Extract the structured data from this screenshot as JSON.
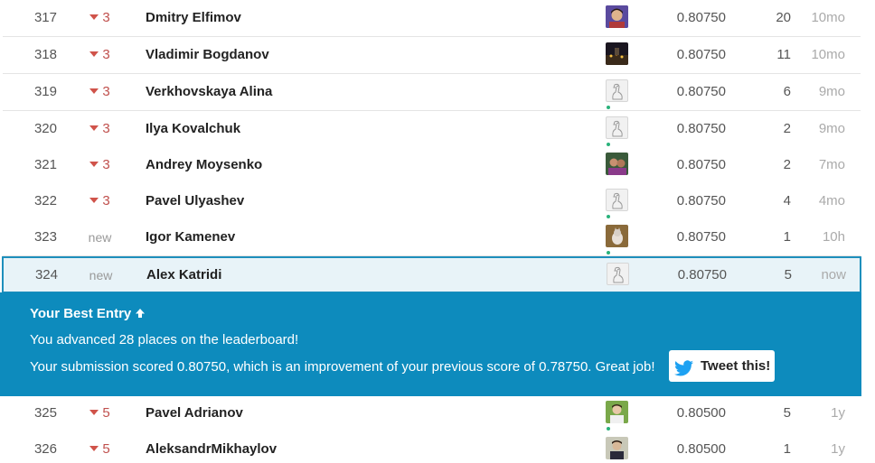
{
  "leaderboard": {
    "rows_before": [
      {
        "rank": "317",
        "delta": "3",
        "delta_type": "down",
        "name": "Dmitry Elfimov",
        "avatar": "avatar-photo-person",
        "score": "0.80750",
        "entries": "20",
        "last": "10mo"
      },
      {
        "rank": "318",
        "delta": "3",
        "delta_type": "down",
        "name": "Vladimir Bogdanov",
        "avatar": "avatar-photo-night-city",
        "score": "0.80750",
        "entries": "11",
        "last": "10mo"
      },
      {
        "rank": "319",
        "delta": "3",
        "delta_type": "down",
        "name": "Verkhovskaya Alina",
        "avatar": "avatar-default-goose",
        "score": "0.80750",
        "entries": "6",
        "last": "9mo"
      },
      {
        "rank": "320",
        "delta": "3",
        "delta_type": "down",
        "name": "Ilya Kovalchuk",
        "avatar": "avatar-default-goose",
        "score": "0.80750",
        "entries": "2",
        "last": "9mo"
      },
      {
        "rank": "321",
        "delta": "3",
        "delta_type": "down",
        "name": "Andrey Moysenko",
        "avatar": "avatar-photo-people",
        "score": "0.80750",
        "entries": "2",
        "last": "7mo"
      },
      {
        "rank": "322",
        "delta": "3",
        "delta_type": "down",
        "name": "Pavel Ulyashev",
        "avatar": "avatar-default-goose",
        "score": "0.80750",
        "entries": "4",
        "last": "4mo"
      },
      {
        "rank": "323",
        "delta": "new",
        "delta_type": "new",
        "name": "Igor Kamenev",
        "avatar": "avatar-photo-cat",
        "score": "0.80750",
        "entries": "1",
        "last": "10h"
      },
      {
        "rank": "324",
        "delta": "new",
        "delta_type": "new",
        "name": "Alex Katridi",
        "avatar": "avatar-default-goose",
        "score": "0.80750",
        "entries": "5",
        "last": "now"
      }
    ],
    "banner": {
      "title": "Your Best Entry",
      "title_icon": "arrow-up-icon",
      "line1": "You advanced 28 places on the leaderboard!",
      "line2": "Your submission scored 0.80750, which is an improvement of your previous score of 0.78750. Great job!",
      "tweet_label": "Tweet this!",
      "tweet_icon": "twitter-bird-icon"
    },
    "rows_after": [
      {
        "rank": "325",
        "delta": "5",
        "delta_type": "down",
        "name": "Pavel Adrianov",
        "avatar": "avatar-photo-person-green",
        "score": "0.80500",
        "entries": "5",
        "last": "1y"
      },
      {
        "rank": "326",
        "delta": "5",
        "delta_type": "down",
        "name": "AleksandrMikhaylov",
        "avatar": "avatar-photo-person-dark",
        "score": "0.80500",
        "entries": "1",
        "last": "1y"
      }
    ]
  },
  "colors": {
    "accent": "#0d8bbd",
    "highlight_row": "#e8f3f8",
    "down_delta": "#c0504d",
    "online": "#2ab27b"
  }
}
